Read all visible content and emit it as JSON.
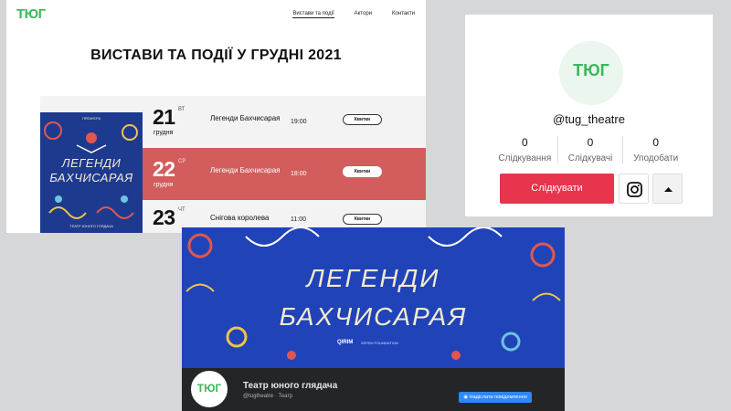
{
  "site": {
    "logo": "ТЮГ",
    "nav": [
      "Вистави та події",
      "Актори",
      "Контакти"
    ],
    "title": "ВИСТАВИ ТА ПОДІЇ У ГРУДНІ 2021",
    "poster": {
      "top_text": "ПРЕМ'ЄРА",
      "title_line1": "ЛЕГЕНДИ",
      "title_line2": "БАХЧИСАРАЯ",
      "bottom_text": "ТЕАТР ЮНОГО ГЛЯДАЧА"
    },
    "events": [
      {
        "day": "21",
        "dow": "ВТ",
        "month": "грудня",
        "title": "Легенди Бахчисарая",
        "time": "19:00",
        "button": "Квитки"
      },
      {
        "day": "22",
        "dow": "СР",
        "month": "грудня",
        "title": "Легенди Бахчисарая",
        "time": "18:00",
        "button": "Квитки"
      },
      {
        "day": "23",
        "dow": "ЧТ",
        "month": "",
        "title": "Снігова королева",
        "time": "11:00",
        "button": "Квитки"
      }
    ]
  },
  "tiktok": {
    "avatar_text": "ТЮГ",
    "handle": "@tug_theatre",
    "stats": [
      {
        "value": "0",
        "label": "Слідкування"
      },
      {
        "value": "0",
        "label": "Слідкувачі"
      },
      {
        "value": "0",
        "label": "Уподобати"
      }
    ],
    "follow_label": "Слідкувати"
  },
  "facebook": {
    "cover_line1": "ЛЕГЕНДИ",
    "cover_line2": "БАХЧИСАРАЯ",
    "sponsor1": "QIRIM",
    "sponsor2": "ZEFEM FOUNDATION",
    "avatar_text": "ТЮГ",
    "page_name": "Театр юного глядача",
    "page_sub": "@tugtheatre · Театр",
    "message_button": "Надіслати повідомлення"
  },
  "colors": {
    "brand_green": "#3bb85a",
    "highlight_red": "#d35c5c",
    "tiktok_red": "#e8344d",
    "cover_blue": "#2043b8",
    "fb_blue": "#2d88ff"
  }
}
